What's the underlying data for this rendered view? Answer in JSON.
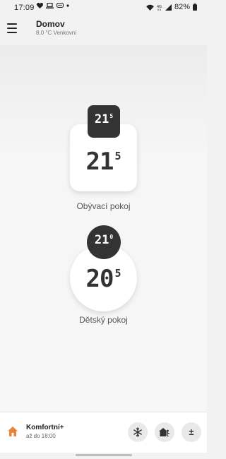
{
  "status_bar": {
    "time": "17:09",
    "battery": "82%",
    "left_icons": [
      "heart-icon",
      "laptop-icon",
      "chat-icon",
      "dot-icon"
    ],
    "right_icons": [
      "wifi-icon",
      "4g-icon",
      "signal-icon",
      "battery-icon"
    ]
  },
  "header": {
    "title": "Domov",
    "subtitle": "8.0 °C Venkovní"
  },
  "rooms": [
    {
      "name": "Obývací pokoj",
      "device": "thermostat",
      "set_temp_int": "21",
      "set_temp_dec": "5",
      "current_temp_int": "21",
      "current_temp_dec": "5"
    },
    {
      "name": "Dětský pokoj",
      "device": "valve",
      "set_temp_int": "21",
      "set_temp_dec": "0",
      "current_temp_int": "20",
      "current_temp_dec": "5"
    }
  ],
  "bottom_bar": {
    "mode_title": "Komfortní+",
    "mode_subtitle": "až do 18:00",
    "adjust_label": "±",
    "accent_color": "#e8863a"
  }
}
